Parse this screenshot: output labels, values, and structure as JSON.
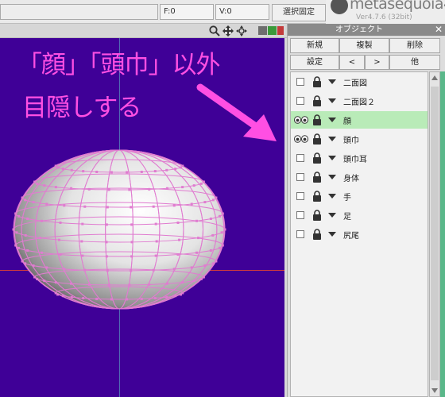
{
  "status": {
    "f_label": "F:0",
    "v_label": "V:0",
    "fix_button": "選択固定"
  },
  "logo": {
    "text": "metasequoia4",
    "version": "Ver4.7.6 (32bit)"
  },
  "annotation": {
    "line1": "「顔」「頭巾」以外",
    "line2": "目隠しする",
    "color": "#ff4fe3"
  },
  "panel": {
    "title": "オブジェクト",
    "close": "✕",
    "buttons": {
      "new": "新規",
      "duplicate": "複製",
      "delete": "削除",
      "settings": "設定",
      "prev": "<",
      "next": ">",
      "other": "他"
    },
    "objects": [
      {
        "name": "二面図",
        "visible": false,
        "selected": false
      },
      {
        "name": "二面図２",
        "visible": false,
        "selected": false
      },
      {
        "name": "顔",
        "visible": true,
        "selected": true
      },
      {
        "name": "頭巾",
        "visible": true,
        "selected": false
      },
      {
        "name": "頭巾耳",
        "visible": false,
        "selected": false
      },
      {
        "name": "身体",
        "visible": false,
        "selected": false
      },
      {
        "name": "手",
        "visible": false,
        "selected": false
      },
      {
        "name": "足",
        "visible": false,
        "selected": false
      },
      {
        "name": "尻尾",
        "visible": false,
        "selected": false
      }
    ]
  },
  "colors": {
    "viewport_bg": "#3f0097",
    "wire": "#e07cd0",
    "selection": "#b9ebb8",
    "accent": "#5ab88a"
  },
  "icons": [
    "magnifier-icon",
    "move-icon",
    "rotate-icon",
    "view-layout-icon",
    "eye-icon",
    "lock-icon",
    "expand-triangle-icon"
  ]
}
